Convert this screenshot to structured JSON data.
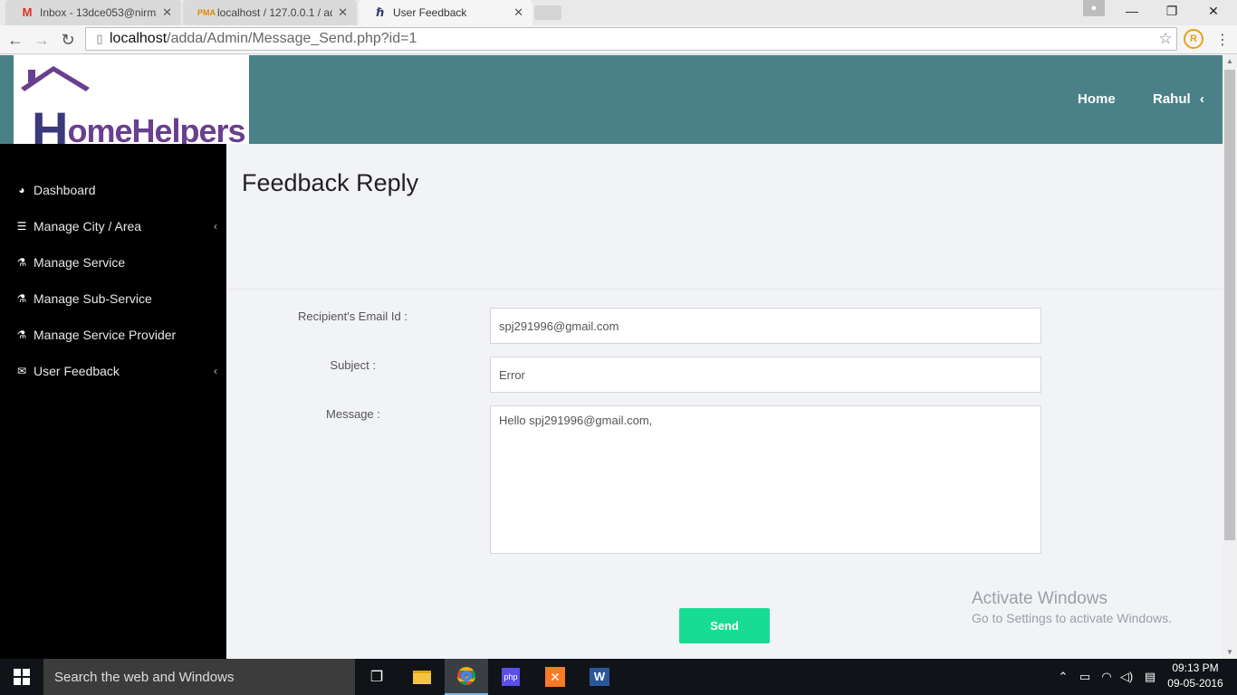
{
  "browser": {
    "tabs": [
      {
        "title": "Inbox - 13dce053@nirma…",
        "icon": "gmail-icon"
      },
      {
        "title": "localhost / 127.0.0.1 / add",
        "icon": "phpmyadmin-icon"
      },
      {
        "title": "User Feedback",
        "icon": "homehelpers-icon"
      }
    ],
    "url_host": "localhost",
    "url_path": "/adda/Admin/Message_Send.php?id=1"
  },
  "header": {
    "logo_initial": "H",
    "logo_rest": "omeHelpers",
    "nav": {
      "home": "Home",
      "user": "Rahul"
    }
  },
  "sidebar": {
    "items": [
      {
        "label": "Dashboard",
        "icon": "dashboard-icon",
        "has_submenu": false
      },
      {
        "label": "Manage City / Area",
        "icon": "list-icon",
        "has_submenu": true
      },
      {
        "label": "Manage Service",
        "icon": "flask-icon",
        "has_submenu": false
      },
      {
        "label": "Manage Sub-Service",
        "icon": "flask-icon",
        "has_submenu": false
      },
      {
        "label": "Manage Service Provider",
        "icon": "flask-icon",
        "has_submenu": false
      },
      {
        "label": "User Feedback",
        "icon": "envelope-icon",
        "has_submenu": true
      }
    ]
  },
  "main": {
    "title": "Feedback Reply",
    "form": {
      "email_label": "Recipient's Email Id :",
      "email_value": "spj291996@gmail.com",
      "subject_label": "Subject :",
      "subject_value": "Error",
      "message_label": "Message :",
      "message_value": "Hello spj291996@gmail.com,",
      "send_label": "Send"
    }
  },
  "watermark": {
    "line1": "Activate Windows",
    "line2": "Go to Settings to activate Windows."
  },
  "taskbar": {
    "search_placeholder": "Search the web and Windows",
    "time": "09:13 PM",
    "date": "09-05-2016"
  },
  "colors": {
    "header_bg": "#4a8088",
    "sidebar_bg": "#000000",
    "send_button": "#17dc91",
    "logo_purple": "#6a3f8f"
  }
}
